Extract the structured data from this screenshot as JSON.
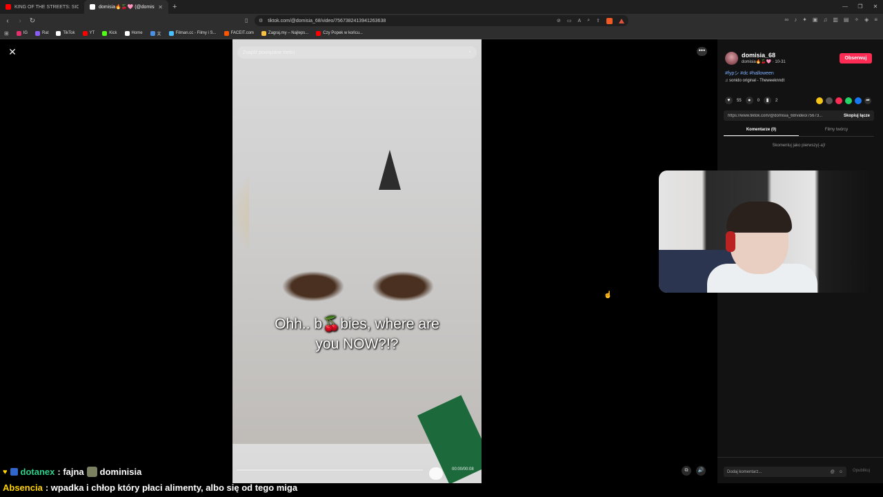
{
  "browser": {
    "tabs": [
      {
        "title": "KING OF THE STREETS: SICKO MODE",
        "active": false
      },
      {
        "title": "domisia🔥🍒🩷 (@domisia",
        "active": true
      }
    ],
    "url": "tiktok.com/@domisia_68/video/7567382413941263638",
    "bookmarks": [
      {
        "label": "IG",
        "icon": "instagram-icon",
        "color": "#e1306c"
      },
      {
        "label": "Rat",
        "icon": "rat-icon",
        "color": "#8a5cf6"
      },
      {
        "label": "TikTok",
        "icon": "tiktok-icon",
        "color": "#ffffff"
      },
      {
        "label": "YT",
        "icon": "youtube-icon",
        "color": "#ff0000"
      },
      {
        "label": "Kick",
        "icon": "kick-icon",
        "color": "#53fc18"
      },
      {
        "label": "Home",
        "icon": "x-icon",
        "color": "#ffffff"
      },
      {
        "label": "文",
        "icon": "translate-icon",
        "color": "#4a90e2"
      },
      {
        "label": "Filman.cc - Filmy i S...",
        "icon": "filman-icon",
        "color": "#4ac0ff"
      },
      {
        "label": "FACEIT.com",
        "icon": "faceit-icon",
        "color": "#ff5500"
      },
      {
        "label": "Zagraj.my – Najleps...",
        "icon": "zagraj-icon",
        "color": "#f7c244"
      },
      {
        "label": "Czy Popek w końcu...",
        "icon": "popek-icon",
        "color": "#ff0000"
      }
    ]
  },
  "video": {
    "search_placeholder": "Znajdź powiązane treści",
    "caption_line1": "Ohh.. b🍒bies, where are",
    "caption_line2": "you NOW?!?",
    "time": "00:00/00:08",
    "progress": 0.0
  },
  "panel": {
    "username": "domisia_68",
    "nickname": "domisia🔥🍒🩷 · 10-31",
    "follow": "Obserwuj",
    "tags": "#fypシ #dc #halloween",
    "sound": "sonido original - Theweeknndt",
    "likes": "55",
    "comments": "0",
    "saves": "2",
    "link": "https://www.tiktok.com/@domisia_68/video/75673...",
    "copy_link": "Skopiuj łącze",
    "tab_comments": "Komentarze (0)",
    "tab_creator": "Filmy twórcy",
    "empty_comments": "Skomentuj jako pierwszy(-a)!",
    "comment_placeholder": "Dodaj komentarz...",
    "post": "Opublikuj"
  },
  "chat": [
    {
      "user": "dotanex",
      "text": " : fajna ",
      "extra": "dominisia",
      "user_color": "#2fd08a"
    },
    {
      "user": "Absencia",
      "text": " : wpadka i chłop który płaci alimenty, albo się od tego miga",
      "user_color": "#ffd400"
    }
  ]
}
